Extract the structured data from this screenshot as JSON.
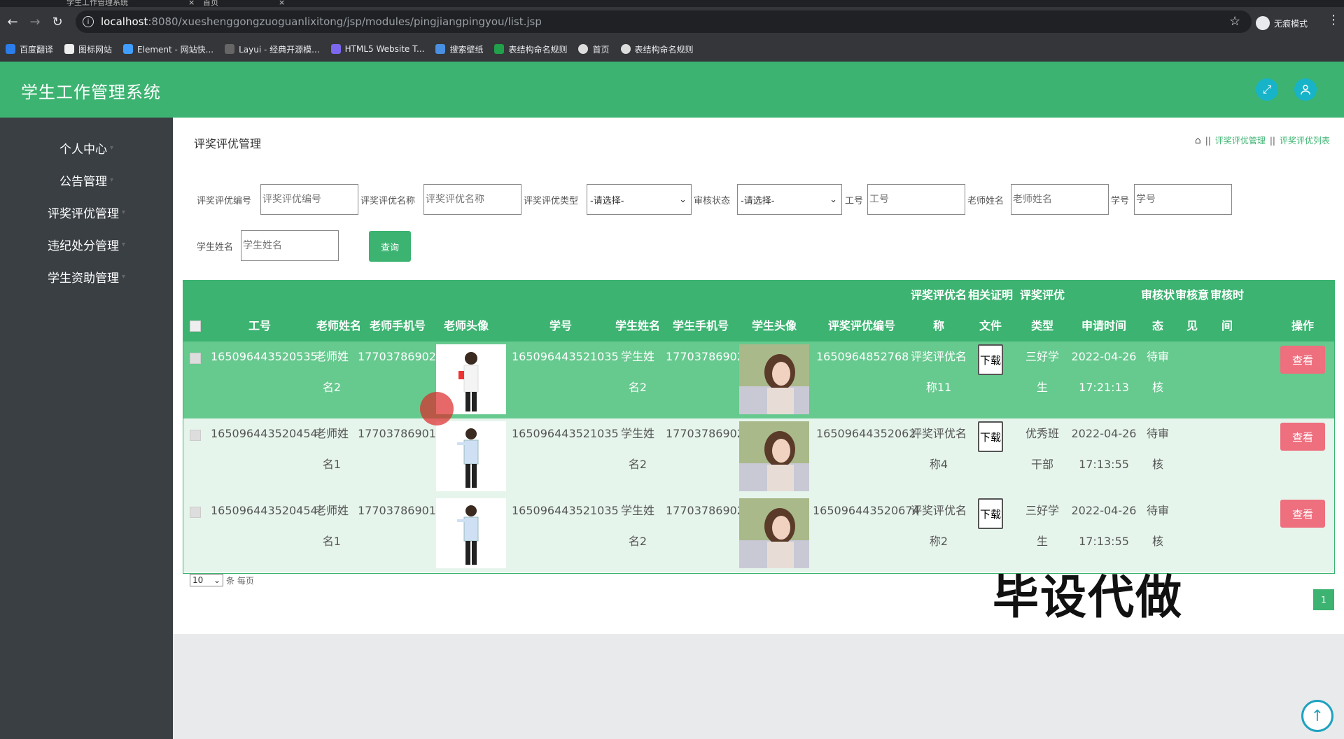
{
  "browser": {
    "tabs": [
      "学生工作管理系统",
      "首页"
    ],
    "url_host": "localhost",
    "url_path": ":8080/xueshenggongzuoguanlixitong/jsp/modules/pingjiangpingyou/list.jsp",
    "incognito_label": "无痕模式",
    "bookmarks": [
      "百度翻译",
      "图标网站",
      "Element - 网站快...",
      "Layui - 经典开源模...",
      "HTML5 Website T...",
      "搜索壁纸",
      "表结构命名规则",
      "首页",
      "表结构命名规则"
    ]
  },
  "header": {
    "title": "学生工作管理系统"
  },
  "sidebar": {
    "items": [
      {
        "label": "个人中心"
      },
      {
        "label": "公告管理"
      },
      {
        "label": "评奖评优管理"
      },
      {
        "label": "违纪处分管理"
      },
      {
        "label": "学生资助管理"
      }
    ]
  },
  "page": {
    "title": "评奖评优管理",
    "breadcrumb": [
      "评奖评优管理",
      "评奖评优列表"
    ]
  },
  "filters": {
    "award_no_label": "评奖评优编号",
    "award_no_placeholder": "评奖评优编号",
    "award_name_label": "评奖评优名称",
    "award_name_placeholder": "评奖评优名称",
    "award_type_label": "评奖评优类型",
    "award_type_value": "-请选择-",
    "audit_status_label": "审核状态",
    "audit_status_value": "-请选择-",
    "staff_no_label": "工号",
    "staff_no_placeholder": "工号",
    "teacher_name_label": "老师姓名",
    "teacher_name_placeholder": "老师姓名",
    "student_no_label": "学号",
    "student_no_placeholder": "学号",
    "student_name_label": "学生姓名",
    "student_name_placeholder": "学生姓名",
    "query_label": "查询"
  },
  "table": {
    "headers": {
      "staff_no": "工号",
      "teacher_name": "老师姓名",
      "teacher_phone": "老师手机号",
      "teacher_avatar": "老师头像",
      "student_no": "学号",
      "student_name": "学生姓名",
      "student_phone": "学生手机号",
      "student_avatar": "学生头像",
      "award_no": "评奖评优编号",
      "award_name_1": "评奖评优名",
      "award_name_2": "称",
      "cert_1": "相关证明",
      "cert_2": "文件",
      "type_1": "评奖评优",
      "type_2": "类型",
      "apply_time": "申请时间",
      "status_1": "审核状",
      "status_2": "态",
      "opinion_1": "审核意",
      "opinion_2": "见",
      "audit_time_1": "审核时",
      "audit_time_2": "间",
      "action": "操作"
    },
    "rows": [
      {
        "staff_no": "165096443520535",
        "teacher_name_1": "老师姓",
        "teacher_name_2": "名2",
        "teacher_phone": "17703786902",
        "student_no": "165096443521035",
        "student_name_1": "学生姓",
        "student_name_2": "名2",
        "student_phone": "17703786902",
        "award_no": "1650964852768",
        "award_name_1": "评奖评优名",
        "award_name_2": "称11",
        "download": "下载",
        "type_1": "三好学",
        "type_2": "生",
        "apply_date": "2022-04-26",
        "apply_clock": "17:21:13",
        "status_1": "待审",
        "status_2": "核",
        "view": "查看"
      },
      {
        "staff_no": "165096443520454",
        "teacher_name_1": "老师姓",
        "teacher_name_2": "名1",
        "teacher_phone": "17703786901",
        "student_no": "165096443521035",
        "student_name_1": "学生姓",
        "student_name_2": "名2",
        "student_phone": "17703786902",
        "award_no": "16509644352062",
        "award_name_1": "评奖评优名",
        "award_name_2": "称4",
        "download": "下载",
        "type_1": "优秀班",
        "type_2": "干部",
        "apply_date": "2022-04-26",
        "apply_clock": "17:13:55",
        "status_1": "待审",
        "status_2": "核",
        "view": "查看"
      },
      {
        "staff_no": "165096443520454",
        "teacher_name_1": "老师姓",
        "teacher_name_2": "名1",
        "teacher_phone": "17703786901",
        "student_no": "165096443521035",
        "student_name_1": "学生姓",
        "student_name_2": "名2",
        "student_phone": "17703786902",
        "award_no": "165096443520674",
        "award_name_1": "评奖评优名",
        "award_name_2": "称2",
        "download": "下载",
        "type_1": "三好学",
        "type_2": "生",
        "apply_date": "2022-04-26",
        "apply_clock": "17:13:55",
        "status_1": "待审",
        "status_2": "核",
        "view": "查看"
      }
    ]
  },
  "pagination": {
    "page_size": "10",
    "per_page_label": "条 每页",
    "current_page": "1"
  },
  "watermark": "毕设代做",
  "colors": {
    "header_green": "#3cb371",
    "sidebar": "#3a3f44",
    "view_button": "#ee6f7e"
  }
}
